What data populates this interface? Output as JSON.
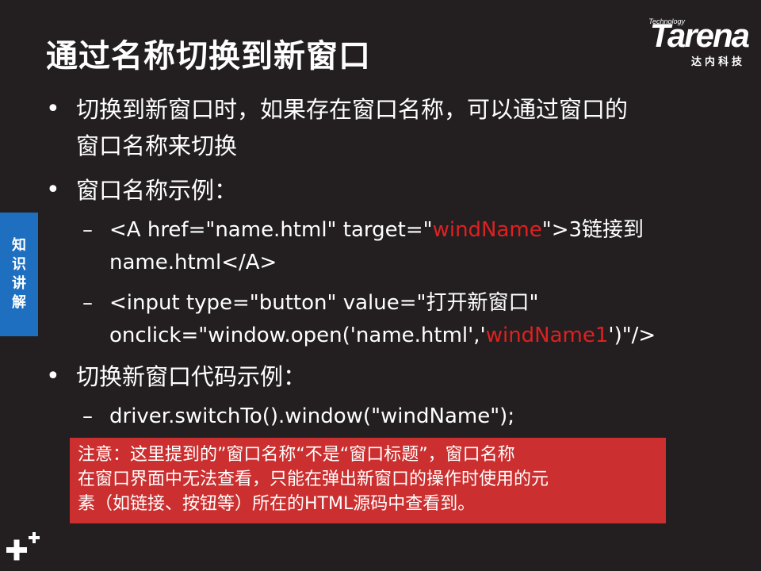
{
  "title": "通过名称切换到新窗口",
  "logo": {
    "tech": "Technology",
    "word": "Tarena",
    "cn": "达内科技"
  },
  "side_tab": [
    "知",
    "识",
    "讲",
    "解"
  ],
  "bullets": [
    {
      "lines": [
        "切换到新窗口时，如果存在窗口名称，可以通过窗口的",
        "窗口名称来切换"
      ]
    },
    {
      "lines": [
        "窗口名称示例："
      ],
      "subs": [
        {
          "line1_a": "<A href=\"name.html\"  target=\"",
          "line1_red": "windName",
          "line1_b": "\">3链接到",
          "line2": "name.html</A>"
        },
        {
          "line1": "<input type=\"button\" value=\"打开新窗口\"",
          "line2_a": "onclick=\"window.open('name.html','",
          "line2_red": "windName1",
          "line2_b": "')\"/>"
        }
      ]
    },
    {
      "lines": [
        "切换新窗口代码示例："
      ],
      "subs": [
        {
          "line1": "driver.switchTo().window(\"windName\");"
        }
      ]
    }
  ],
  "note": {
    "lines": [
      "注意：这里提到的”窗口名称“不是“窗口标题”，窗口名称",
      "在窗口界面中无法查看，只能在弹出新窗口的操作时使用的元",
      "素（如链接、按钮等）所在的HTML源码中查看到。"
    ]
  },
  "colors": {
    "background": "#231f20",
    "accent_red": "#e02020",
    "note_bg": "#cc2f2f",
    "side_tab": "#1e6fc0"
  },
  "icons": {
    "bullet": "bullet-dot",
    "corner": "plus-mark-icon"
  }
}
